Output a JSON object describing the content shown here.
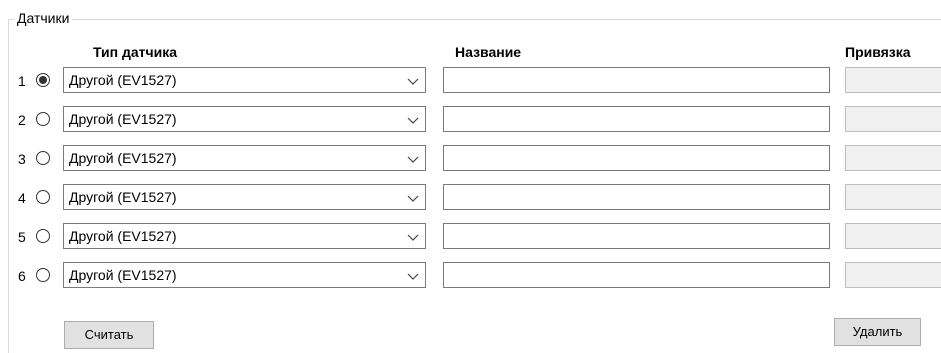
{
  "group": {
    "title": "Датчики"
  },
  "columns": {
    "type": "Тип датчика",
    "name": "Название",
    "binding": "Привязка"
  },
  "sensors": [
    {
      "number": "1",
      "selected": true,
      "type": "Другой (EV1527)",
      "name": "",
      "binding": ""
    },
    {
      "number": "2",
      "selected": false,
      "type": "Другой (EV1527)",
      "name": "",
      "binding": ""
    },
    {
      "number": "3",
      "selected": false,
      "type": "Другой (EV1527)",
      "name": "",
      "binding": ""
    },
    {
      "number": "4",
      "selected": false,
      "type": "Другой (EV1527)",
      "name": "",
      "binding": ""
    },
    {
      "number": "5",
      "selected": false,
      "type": "Другой (EV1527)",
      "name": "",
      "binding": ""
    },
    {
      "number": "6",
      "selected": false,
      "type": "Другой (EV1527)",
      "name": "",
      "binding": ""
    }
  ],
  "buttons": {
    "read": "Считать",
    "delete": "Удалить"
  },
  "icons": {
    "combo_arrow": "chevron-down-icon"
  }
}
